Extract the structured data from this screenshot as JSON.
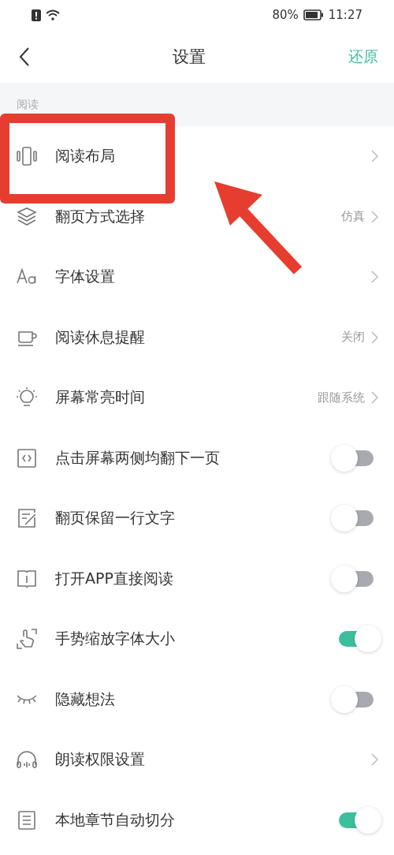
{
  "status_bar": {
    "battery_text": "80%",
    "time": "11:27"
  },
  "header": {
    "title": "设置",
    "action": "还原"
  },
  "section": {
    "title": "阅读"
  },
  "items": [
    {
      "kind": "link",
      "label": "阅读布局"
    },
    {
      "kind": "link",
      "label": "翻页方式选择",
      "value": "仿真"
    },
    {
      "kind": "link",
      "label": "字体设置"
    },
    {
      "kind": "link",
      "label": "阅读休息提醒",
      "value": "关闭"
    },
    {
      "kind": "link",
      "label": "屏幕常亮时间",
      "value": "跟随系统"
    },
    {
      "kind": "toggle",
      "label": "点击屏幕两侧均翻下一页",
      "on": false
    },
    {
      "kind": "toggle",
      "label": "翻页保留一行文字",
      "on": false
    },
    {
      "kind": "toggle",
      "label": "打开APP直接阅读",
      "on": false
    },
    {
      "kind": "toggle",
      "label": "手势缩放字体大小",
      "on": true
    },
    {
      "kind": "toggle",
      "label": "隐藏想法",
      "on": false
    },
    {
      "kind": "link",
      "label": "朗读权限设置"
    },
    {
      "kind": "toggle",
      "label": "本地章节自动切分",
      "on": true
    }
  ]
}
